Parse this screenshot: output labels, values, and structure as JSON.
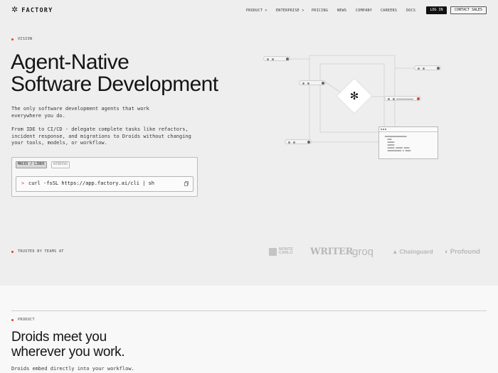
{
  "brand": {
    "name": "FACTORY"
  },
  "nav": {
    "items": [
      "PRODUCT >",
      "ENTERPRISE >",
      "PRICING",
      "NEWS",
      "COMPANY",
      "CAREERS",
      "DOCS"
    ],
    "login_label": "LOG IN",
    "contact_label": "CONTACT SALES"
  },
  "hero": {
    "eyebrow": "VISION",
    "title_line1": "Agent-Native",
    "title_line2": "Software Development",
    "subtitle": "The only software development agents that work everywhere you do.",
    "description": "From IDE to CI/CD - delegate complete tasks like refactors, incident response, and migrations to Droids without changing your tools, models, or workflow."
  },
  "install": {
    "tabs": [
      "MACOS / LINUX",
      "WINDOWS"
    ],
    "active_tab": "MACOS / LINUX",
    "prompt": ">",
    "command": "curl -fsSL https://app.factory.ai/cli | sh"
  },
  "trusted": {
    "label": "TRUSTED BY TEAMS AT",
    "logos": [
      "MONTE CARLO",
      "WRITER",
      "groq",
      "Chainguard",
      "Profound"
    ]
  },
  "product": {
    "eyebrow": "PRODUCT",
    "title_line1": "Droids meet you",
    "title_line2": "wherever you work.",
    "description": "Droids embed directly into your workflow."
  },
  "colors": {
    "accent": "#e0431a",
    "background": "#eeeeee"
  },
  "icons": [
    "factory-logo-icon",
    "copy-icon",
    "droid-icon"
  ]
}
